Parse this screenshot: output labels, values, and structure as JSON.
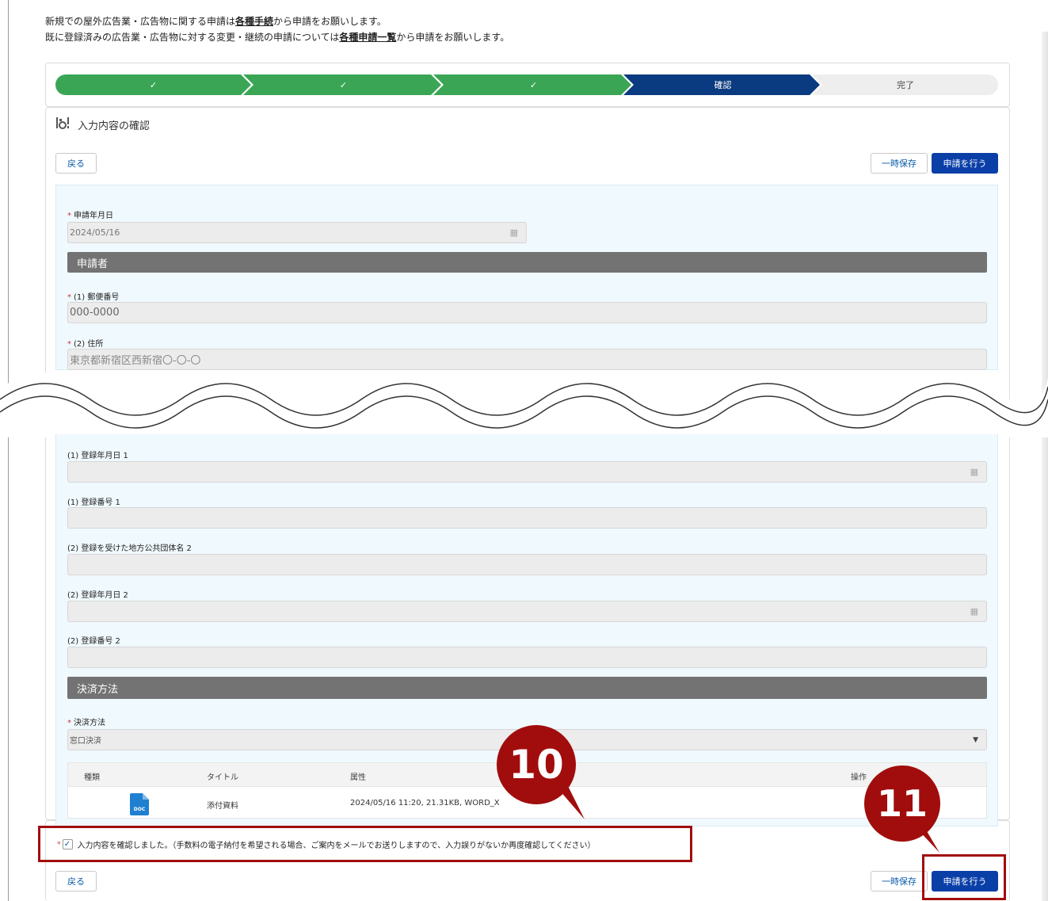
{
  "notice": {
    "line1_before": "新規での屋外広告業・広告物に関する申請は",
    "line1_link": "各種手続",
    "line1_after": "から申請をお願いします。",
    "line2_before": "既に登録済みの広告業・広告物に対する変更・継続の申請については",
    "line2_link": "各種申請一覧",
    "line2_after": "から申請をお願いします。"
  },
  "progress": {
    "steps": [
      {
        "label": "✓",
        "state": "done"
      },
      {
        "label": "✓",
        "state": "done"
      },
      {
        "label": "✓",
        "state": "done"
      },
      {
        "label": "確認",
        "state": "current"
      },
      {
        "label": "完了",
        "state": "pending"
      }
    ],
    "colors": {
      "done": "#3aa655",
      "current": "#0a3a7f",
      "pending": "#eeeeee"
    }
  },
  "section": {
    "icon": "form-check-icon",
    "title": "入力内容の確認"
  },
  "buttons": {
    "back": "戻る",
    "save_draft": "一時保存",
    "submit": "申請を行う"
  },
  "form_top": {
    "application_date_label": "申請年月日",
    "application_date_value": "2024/05/16",
    "applicant_header": "申請者",
    "postal_label": "(1) 郵便番号",
    "postal_value": "000-0000",
    "address_label": "(2) 住所",
    "address_value": "東京都新宿区西新宿〇-〇-〇"
  },
  "form_bottom": {
    "reg_date1_label": "(1) 登録年月日 1",
    "reg_num1_label": "(1) 登録番号 1",
    "gov_name2_label": "(2) 登録を受けた地方公共団体名 2",
    "reg_date2_label": "(2) 登録年月日 2",
    "reg_num2_label": "(2) 登録番号 2",
    "payment_header": "決済方法",
    "payment_label": "決済方法",
    "payment_value": "窓口決済"
  },
  "attachments": {
    "headers": {
      "kind": "種類",
      "title": "タイトル",
      "attribute": "属性",
      "action": "操作"
    },
    "rows": [
      {
        "kind_icon": "doc-file-icon",
        "kind_text": "DOC",
        "title": "添付資料",
        "attribute": "2024/05/16 11:20, 21.31KB, WORD_X"
      }
    ]
  },
  "confirm": {
    "checked": true,
    "text": "入力内容を確認しました。（手数料の電子納付を希望される場合、ご案内をメールでお送りしますので、入力誤りがないか再度確認してください）"
  },
  "annotations": {
    "callout_10": "10",
    "callout_11": "11",
    "color": "#a10d0d"
  }
}
